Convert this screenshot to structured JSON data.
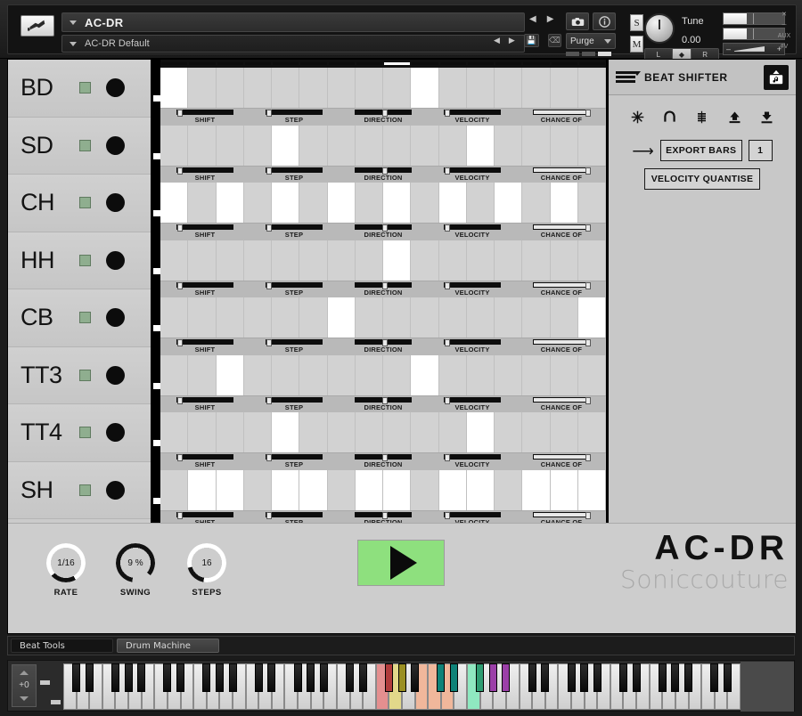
{
  "header": {
    "instrument_name": "AC-DR",
    "preset_name": "AC-DR Default",
    "wrench_icon": "wrench-icon",
    "prev_icon": "previous-arrow-icon",
    "next_icon": "next-arrow-icon",
    "camera_icon": "camera-icon",
    "info_icon": "info-icon",
    "save_icon": "save-disk-icon",
    "trash_icon": "trash-icon",
    "purge_label": "Purge",
    "solo_label": "S",
    "mute_label": "M",
    "tune_label": "Tune",
    "tune_value": "0.00",
    "pan_left": "L",
    "pan_right": "R",
    "minimize_labels": [
      "x",
      "-",
      "AUX",
      "#V"
    ]
  },
  "instruments": [
    {
      "name": "BD",
      "mute_color": "#8fae8f"
    },
    {
      "name": "SD",
      "mute_color": "#8fae8f"
    },
    {
      "name": "CH",
      "mute_color": "#8fae8f"
    },
    {
      "name": "HH",
      "mute_color": "#8fae8f"
    },
    {
      "name": "CB",
      "mute_color": "#8fae8f"
    },
    {
      "name": "TT3",
      "mute_color": "#8fae8f"
    },
    {
      "name": "TT4",
      "mute_color": "#8fae8f"
    },
    {
      "name": "SH",
      "mute_color": "#8fae8f"
    }
  ],
  "sequencer": {
    "step_count": 16,
    "playhead_step": 9,
    "control_labels": [
      "SHIFT",
      "STEP",
      "DIRECTION",
      "VELOCITY",
      "CHANCE OF"
    ],
    "rows": [
      {
        "instrument": "BD",
        "steps": [
          1,
          0,
          0,
          0,
          0,
          0,
          0,
          0,
          0,
          1,
          0,
          0,
          0,
          0,
          0,
          0
        ]
      },
      {
        "instrument": "SD",
        "steps": [
          0,
          0,
          0,
          0,
          1,
          0,
          0,
          0,
          0,
          0,
          0,
          1,
          0,
          0,
          0,
          0
        ]
      },
      {
        "instrument": "CH",
        "steps": [
          1,
          0,
          1,
          0,
          1,
          0,
          1,
          0,
          1,
          0,
          1,
          0,
          1,
          0,
          1,
          0
        ]
      },
      {
        "instrument": "HH",
        "steps": [
          0,
          0,
          0,
          0,
          0,
          0,
          0,
          0,
          1,
          0,
          0,
          0,
          0,
          0,
          0,
          0
        ]
      },
      {
        "instrument": "CB",
        "steps": [
          0,
          0,
          0,
          0,
          0,
          0,
          1,
          0,
          0,
          0,
          0,
          0,
          0,
          0,
          0,
          1
        ]
      },
      {
        "instrument": "TT3",
        "steps": [
          0,
          0,
          1,
          0,
          0,
          0,
          0,
          0,
          0,
          1,
          0,
          0,
          0,
          0,
          0,
          0
        ]
      },
      {
        "instrument": "TT4",
        "steps": [
          0,
          0,
          0,
          0,
          1,
          0,
          0,
          0,
          0,
          0,
          0,
          1,
          0,
          0,
          0,
          0
        ]
      },
      {
        "instrument": "SH",
        "steps": [
          0,
          1,
          1,
          0,
          1,
          1,
          0,
          1,
          1,
          0,
          1,
          1,
          0,
          1,
          1,
          1
        ]
      }
    ]
  },
  "beat_shifter": {
    "title": "BEAT SHIFTER",
    "menu_icon": "hamburger-menu-icon",
    "badge_icon": "music-note-upload-icon",
    "tool_icons": [
      "snowflake-icon",
      "undo-arrow-icon",
      "stack-slider-icon",
      "upload-arrow-icon",
      "download-arrow-icon"
    ],
    "arrow_icon": "right-arrow-icon",
    "export_bars_label": "EXPORT BARS",
    "export_bars_count": "1",
    "velocity_quantise_label": "VELOCITY QUANTISE"
  },
  "transport": {
    "knobs": [
      {
        "label": "RATE",
        "value": "1/16"
      },
      {
        "label": "SWING",
        "value": "9 %"
      },
      {
        "label": "STEPS",
        "value": "16"
      }
    ],
    "play_icon": "play-triangle-icon",
    "play_color": "#8ee07e"
  },
  "branding": {
    "title": "AC-DR",
    "maker": "Soniccouture"
  },
  "tabs": [
    {
      "label": "Beat Tools",
      "active": true
    },
    {
      "label": "Drum Machine",
      "active": false
    }
  ],
  "keyboard": {
    "octave_value": "+0",
    "up_icon": "triangle-up-icon",
    "down_icon": "triangle-down-icon",
    "mapped_key_colors": [
      "#e48f8f",
      "#e2d88a",
      "#f0b79b",
      "#0f8278",
      "#2f9d72",
      "#8fe8c0",
      "#9b3fa8"
    ]
  }
}
